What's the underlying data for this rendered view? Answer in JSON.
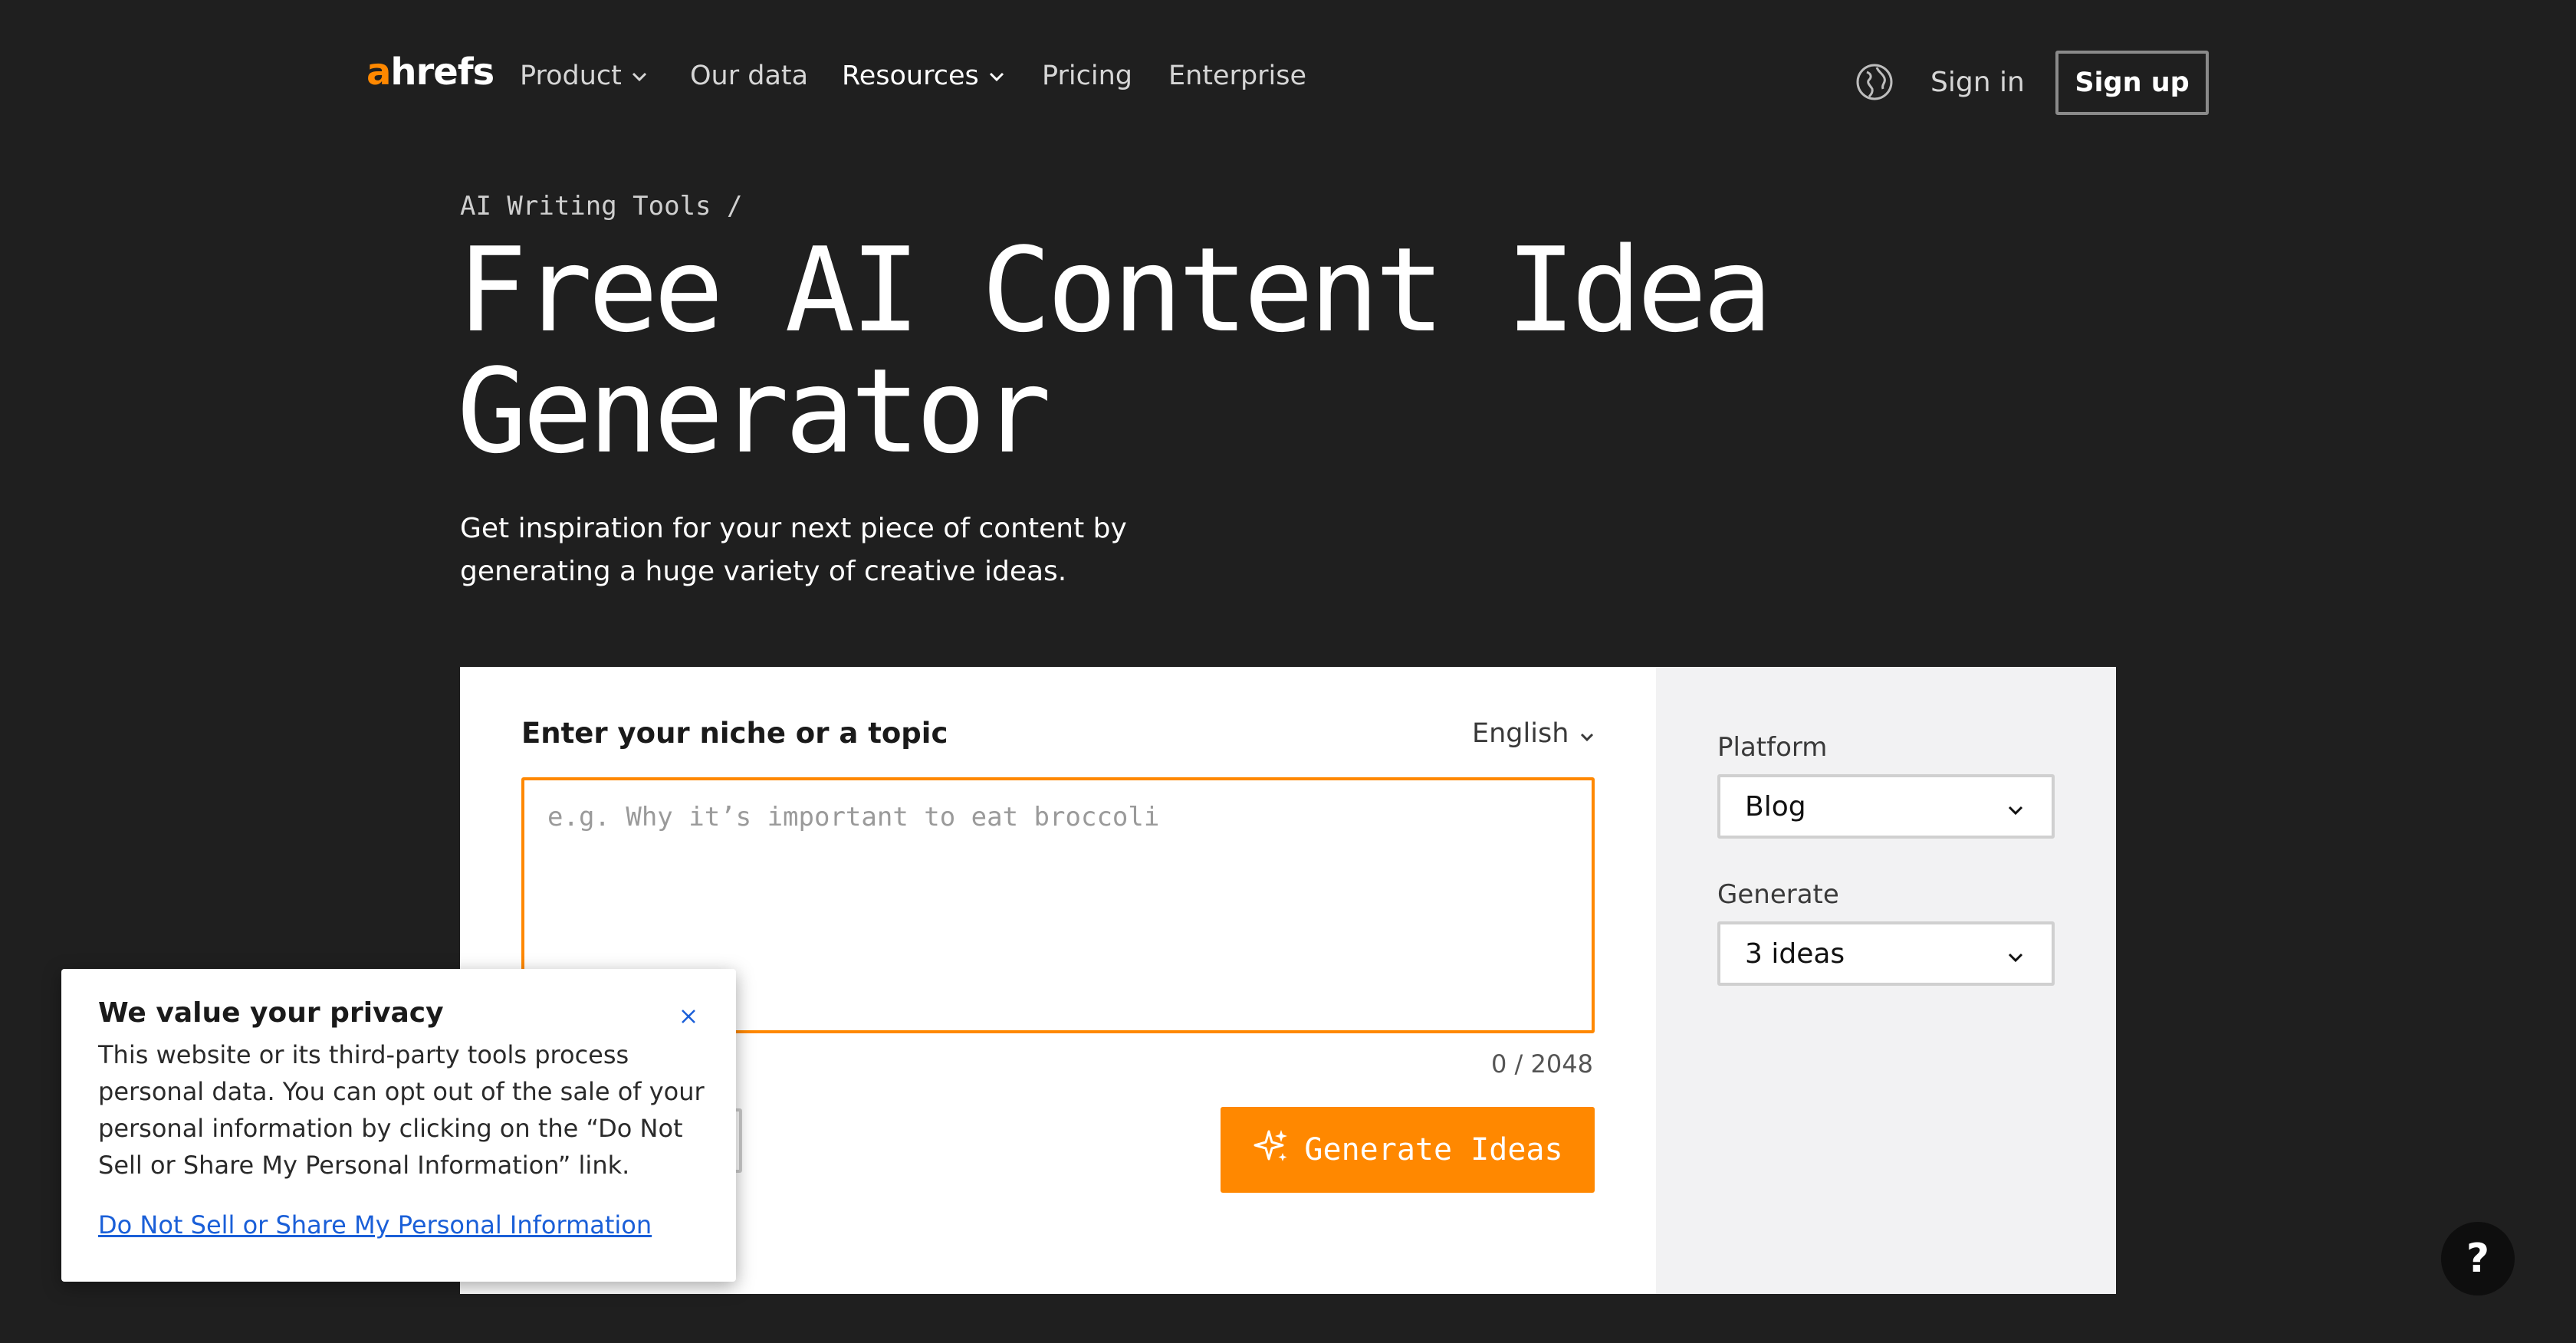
{
  "nav": {
    "logo_a": "a",
    "logo_rest": "hrefs",
    "items": [
      {
        "label": "Product",
        "has_dropdown": true
      },
      {
        "label": "Our data",
        "has_dropdown": false
      },
      {
        "label": "Resources",
        "has_dropdown": true,
        "active": true
      },
      {
        "label": "Pricing",
        "has_dropdown": false
      },
      {
        "label": "Enterprise",
        "has_dropdown": false
      }
    ],
    "globe_icon": "globe-icon",
    "signin": "Sign in",
    "signup": "Sign up"
  },
  "hero": {
    "breadcrumb": "AI Writing Tools /",
    "title_line1": "Free AI Content Idea",
    "title_line2": "Generator",
    "subtitle": "Get inspiration for your next piece of content by generating a huge variety of creative ideas."
  },
  "tool": {
    "topic_label": "Enter your niche or a topic",
    "language": "English",
    "topic_placeholder": "e.g. Why it’s important to eat broccoli",
    "topic_value": "",
    "counter": "0 / 2048",
    "generate_button": "Generate Ideas",
    "generate_icon": "sparkles-icon",
    "platform_label": "Platform",
    "platform_value": "Blog",
    "generate_label": "Generate",
    "generate_value": "3 ideas"
  },
  "privacy": {
    "title": "We value your privacy",
    "body": "This website or its third-party tools process personal data. You can opt out of the sale of your personal information by clicking on the “Do Not Sell or Share My Personal Information” link.",
    "link": "Do Not Sell or Share My Personal Information"
  },
  "help": {
    "label": "?"
  },
  "colors": {
    "background": "#1f1f1f",
    "accent": "#ff8800",
    "link": "#1a5fd8",
    "panel": "#f2f2f3"
  }
}
